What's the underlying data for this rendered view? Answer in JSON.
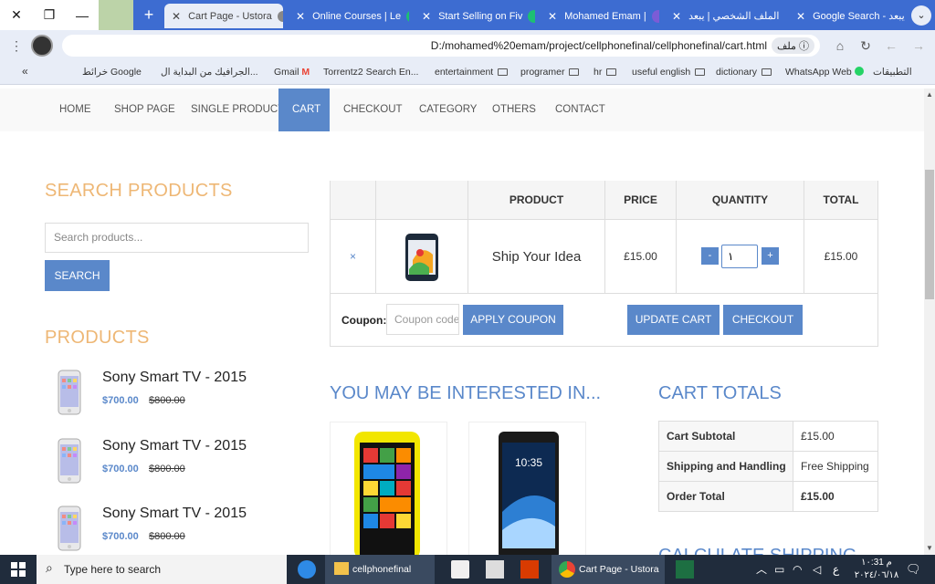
{
  "browser": {
    "tabs": [
      {
        "label": "Cart Page - Ustora",
        "active": true
      },
      {
        "label": "Online Courses | Le"
      },
      {
        "label": "Start Selling on Fiv"
      },
      {
        "label": "Mohamed Emam |"
      },
      {
        "label": "الملف الشخصي | يبعد"
      },
      {
        "label": "Google Search - يبعد"
      }
    ],
    "url": "D:/mohamed%20emam/project/cellphonefinal/cellphonefinal/cart.html",
    "url_chip": "ملف",
    "bookmarks": [
      "التطبيقات",
      "WhatsApp Web",
      "dictionary",
      "useful english",
      "hr",
      "programer",
      "entertainment",
      "Torrentz2 Search En...",
      "Gmail",
      "الجرافيك من البداية ال...",
      "خرائط Google"
    ]
  },
  "nav": {
    "items": [
      "HOME",
      "SHOP PAGE",
      "SINGLE PRODUCT",
      "CART",
      "CHECKOUT",
      "CATEGORY",
      "OTHERS",
      "CONTACT"
    ],
    "active": "CART"
  },
  "sidebar": {
    "search_title": "SEARCH PRODUCTS",
    "search_placeholder": "Search products...",
    "search_button": "SEARCH",
    "products_title": "PRODUCTS",
    "products": [
      {
        "name": "Sony Smart TV - 2015",
        "price": "$700.00",
        "old_price": "$800.00"
      },
      {
        "name": "Sony Smart TV - 2015",
        "price": "$700.00",
        "old_price": "$800.00"
      },
      {
        "name": "Sony Smart TV - 2015",
        "price": "$700.00",
        "old_price": "$800.00"
      }
    ]
  },
  "cart": {
    "headers": [
      "PRODUCT",
      "PRICE",
      "QUANTITY",
      "TOTAL"
    ],
    "row": {
      "remove": "×",
      "name": "Ship Your Idea",
      "price": "£15.00",
      "qty": "١",
      "total": "£15.00"
    },
    "coupon_label": "Coupon:",
    "coupon_placeholder": "Coupon code",
    "apply_button": "APPLY COUPON",
    "update_button": "UPDATE CART",
    "checkout_button": "CHECKOUT"
  },
  "interested_title": "YOU MAY BE INTERESTED IN...",
  "totals": {
    "title": "CART TOTALS",
    "rows": [
      {
        "label": "Cart Subtotal",
        "value": "£15.00"
      },
      {
        "label": "Shipping and Handling",
        "value": "Free Shipping"
      },
      {
        "label": "Order Total",
        "value": "£15.00"
      }
    ]
  },
  "next_section_title": "CALCULATE SHIPPING",
  "taskbar": {
    "search_placeholder": "Type here to search",
    "apps": [
      "cellphonefinal",
      "Cart Page - Ustora ..."
    ],
    "time": "١٠:31 م",
    "date": "٢٠٢٤/٠٦/١٨",
    "lang": "ع"
  },
  "colors": {
    "accent": "#5a88ca",
    "orange": "#eeb775",
    "browser": "#3d6cd1"
  }
}
